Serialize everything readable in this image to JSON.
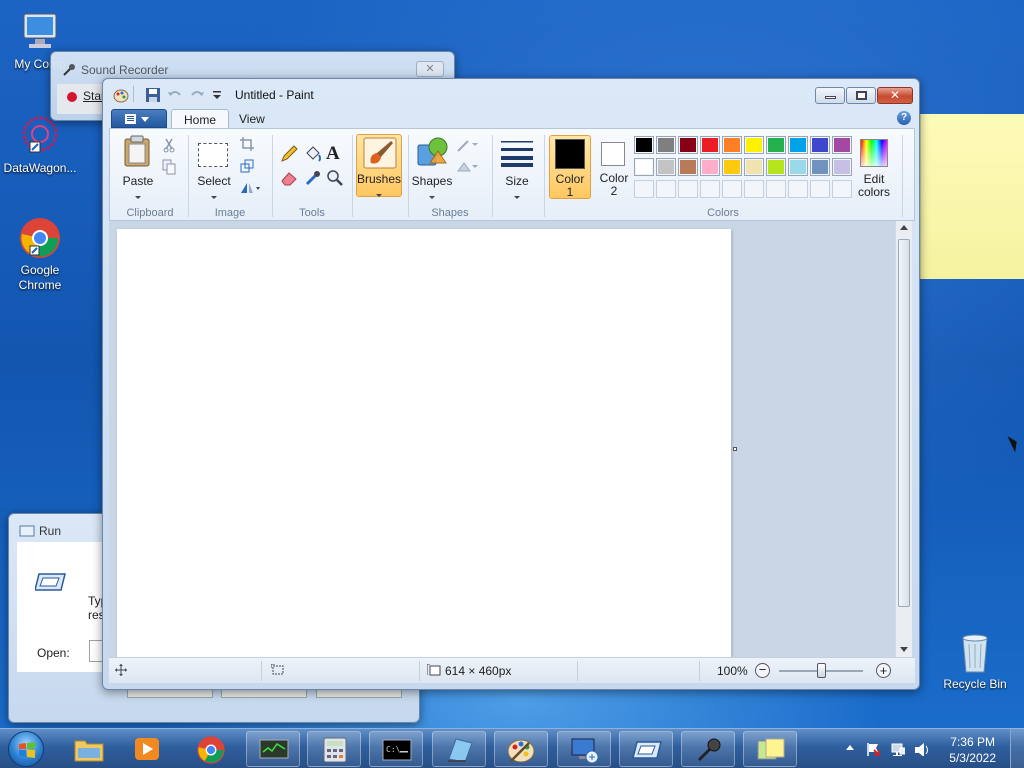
{
  "desktop": {
    "icons": [
      {
        "label": "My Comp"
      },
      {
        "label": "DataWagon..."
      },
      {
        "label": "Google Chrome"
      },
      {
        "label": "Recycle Bin"
      }
    ]
  },
  "sound_recorder": {
    "title": "Sound Recorder",
    "start_label": "Star"
  },
  "run_dialog": {
    "title": "Run",
    "type_text_line1": "Type",
    "type_text_line2": "reso",
    "open_label": "Open:"
  },
  "paint": {
    "title": "Untitled - Paint",
    "tabs": [
      {
        "label": "Home"
      },
      {
        "label": "View"
      }
    ],
    "help_glyph": "?",
    "groups": {
      "clipboard": {
        "label": "Clipboard",
        "paste": "Paste"
      },
      "image": {
        "label": "Image",
        "select": "Select"
      },
      "tools": {
        "label": "Tools",
        "text_glyph": "A"
      },
      "brushes": {
        "label": "Brushes"
      },
      "shapes": {
        "label": "Shapes",
        "button": "Shapes"
      },
      "size": {
        "label": "Size"
      },
      "colors": {
        "label": "Colors",
        "color1_line1": "Color",
        "color1_line2": "1",
        "color2_line1": "Color",
        "color2_line2": "2",
        "edit_line1": "Edit",
        "edit_line2": "colors",
        "color1": "#000000",
        "color2": "#ffffff",
        "palette_row1": [
          "#000000",
          "#7f7f7f",
          "#880015",
          "#ed1c24",
          "#ff7f27",
          "#fff200",
          "#22b14c",
          "#00a2e8",
          "#3f48cc",
          "#a349a4"
        ],
        "palette_row2": [
          "#ffffff",
          "#c3c3c3",
          "#b97a57",
          "#ffaec9",
          "#ffc90e",
          "#efe4b0",
          "#b5e61d",
          "#99d9ea",
          "#7092be",
          "#c8bfe7"
        ]
      }
    },
    "status": {
      "dimensions": "614 × 460px",
      "zoom": "100%"
    }
  },
  "taskbar": {
    "time": "7:36 PM",
    "date": "5/3/2022"
  }
}
